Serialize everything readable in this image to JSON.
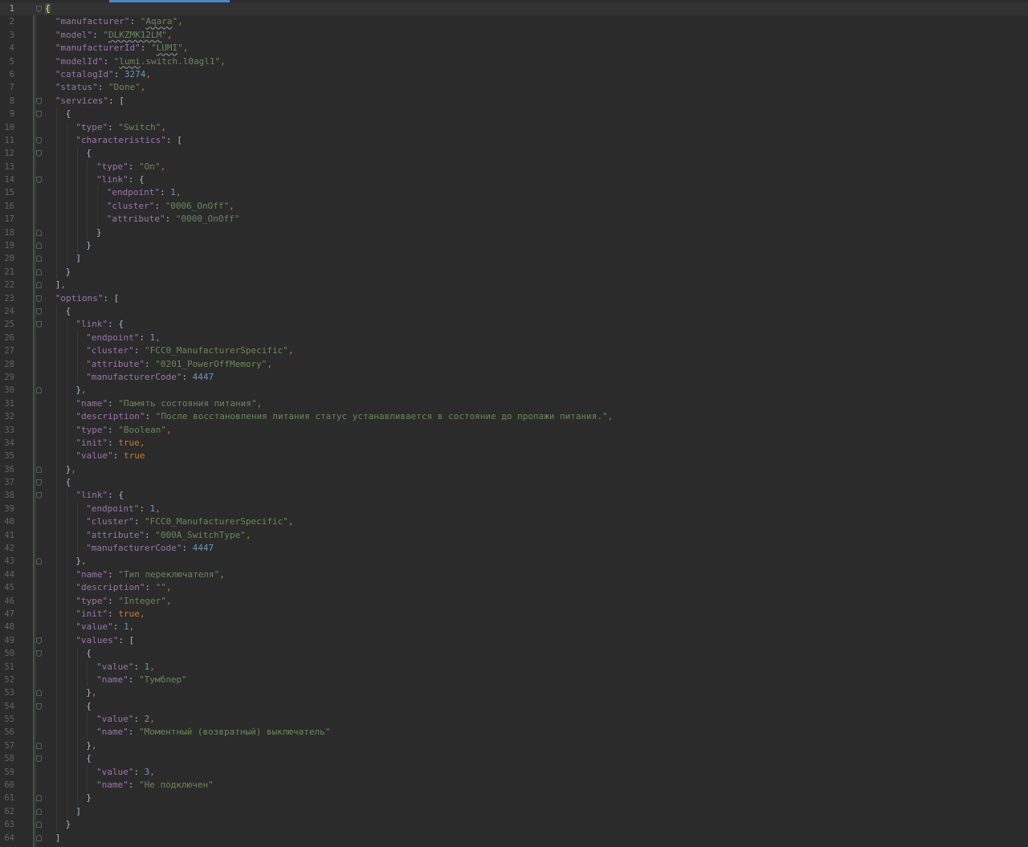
{
  "editor": {
    "active_line": 1,
    "lines": [
      {
        "n": "1",
        "indent": 0,
        "tokens": [
          [
            "brace-hl",
            "{"
          ]
        ],
        "fold": "open"
      },
      {
        "n": "2",
        "indent": 1,
        "tokens": [
          [
            "k",
            "\"manufacturer\""
          ],
          [
            "p",
            ": "
          ],
          [
            "s",
            "\""
          ],
          [
            "s typo",
            "Aqara"
          ],
          [
            "s",
            "\""
          ],
          [
            "cm",
            ","
          ]
        ]
      },
      {
        "n": "3",
        "indent": 1,
        "tokens": [
          [
            "k",
            "\"model\""
          ],
          [
            "p",
            ": "
          ],
          [
            "s",
            "\""
          ],
          [
            "s typo",
            "DLKZMK12LM"
          ],
          [
            "s",
            "\""
          ],
          [
            "cm",
            ","
          ]
        ]
      },
      {
        "n": "4",
        "indent": 1,
        "tokens": [
          [
            "k",
            "\"manufacturerId\""
          ],
          [
            "p",
            ": "
          ],
          [
            "s",
            "\""
          ],
          [
            "s typo",
            "LUMI"
          ],
          [
            "s",
            "\""
          ],
          [
            "cm",
            ","
          ]
        ]
      },
      {
        "n": "5",
        "indent": 1,
        "tokens": [
          [
            "k",
            "\"modelId\""
          ],
          [
            "p",
            ": "
          ],
          [
            "s",
            "\""
          ],
          [
            "s typo",
            "lumi"
          ],
          [
            "s",
            ".switch.l0agl1\""
          ],
          [
            "cm",
            ","
          ]
        ]
      },
      {
        "n": "6",
        "indent": 1,
        "tokens": [
          [
            "k",
            "\"catalogId\""
          ],
          [
            "p",
            ": "
          ],
          [
            "n",
            "3274"
          ],
          [
            "cm",
            ","
          ]
        ]
      },
      {
        "n": "7",
        "indent": 1,
        "tokens": [
          [
            "k",
            "\"status\""
          ],
          [
            "p",
            ": "
          ],
          [
            "s",
            "\"Done\""
          ],
          [
            "cm",
            ","
          ]
        ]
      },
      {
        "n": "8",
        "indent": 1,
        "tokens": [
          [
            "k",
            "\"services\""
          ],
          [
            "p",
            ": ["
          ]
        ],
        "fold": "open"
      },
      {
        "n": "9",
        "indent": 2,
        "tokens": [
          [
            "p",
            "{"
          ]
        ],
        "fold": "open"
      },
      {
        "n": "10",
        "indent": 3,
        "tokens": [
          [
            "k",
            "\"type\""
          ],
          [
            "p",
            ": "
          ],
          [
            "s",
            "\"Switch\""
          ],
          [
            "cm",
            ","
          ]
        ]
      },
      {
        "n": "11",
        "indent": 3,
        "tokens": [
          [
            "k",
            "\"characteristics\""
          ],
          [
            "p",
            ": ["
          ]
        ],
        "fold": "open"
      },
      {
        "n": "12",
        "indent": 4,
        "tokens": [
          [
            "p",
            "{"
          ]
        ],
        "fold": "open"
      },
      {
        "n": "13",
        "indent": 5,
        "tokens": [
          [
            "k",
            "\"type\""
          ],
          [
            "p",
            ": "
          ],
          [
            "s",
            "\"On\""
          ],
          [
            "cm",
            ","
          ]
        ]
      },
      {
        "n": "14",
        "indent": 5,
        "tokens": [
          [
            "k",
            "\"link\""
          ],
          [
            "p",
            ": {"
          ]
        ],
        "fold": "open"
      },
      {
        "n": "15",
        "indent": 6,
        "tokens": [
          [
            "k",
            "\"endpoint\""
          ],
          [
            "p",
            ": "
          ],
          [
            "n",
            "1"
          ],
          [
            "cm",
            ","
          ]
        ]
      },
      {
        "n": "16",
        "indent": 6,
        "tokens": [
          [
            "k",
            "\"cluster\""
          ],
          [
            "p",
            ": "
          ],
          [
            "s",
            "\"0006_OnOff\""
          ],
          [
            "cm",
            ","
          ]
        ]
      },
      {
        "n": "17",
        "indent": 6,
        "tokens": [
          [
            "k",
            "\"attribute\""
          ],
          [
            "p",
            ": "
          ],
          [
            "s",
            "\"0000_OnOff\""
          ]
        ]
      },
      {
        "n": "18",
        "indent": 5,
        "tokens": [
          [
            "p",
            "}"
          ]
        ],
        "fold": "close"
      },
      {
        "n": "19",
        "indent": 4,
        "tokens": [
          [
            "p",
            "}"
          ]
        ],
        "fold": "close"
      },
      {
        "n": "20",
        "indent": 3,
        "tokens": [
          [
            "p",
            "]"
          ]
        ],
        "fold": "close"
      },
      {
        "n": "21",
        "indent": 2,
        "tokens": [
          [
            "p",
            "}"
          ]
        ],
        "fold": "close"
      },
      {
        "n": "22",
        "indent": 1,
        "tokens": [
          [
            "p",
            "]"
          ],
          [
            "cm",
            ","
          ]
        ],
        "fold": "close"
      },
      {
        "n": "23",
        "indent": 1,
        "tokens": [
          [
            "k",
            "\"options\""
          ],
          [
            "p",
            ": ["
          ]
        ],
        "fold": "open"
      },
      {
        "n": "24",
        "indent": 2,
        "tokens": [
          [
            "p",
            "{"
          ]
        ],
        "fold": "open"
      },
      {
        "n": "25",
        "indent": 3,
        "tokens": [
          [
            "k",
            "\"link\""
          ],
          [
            "p",
            ": {"
          ]
        ],
        "fold": "open"
      },
      {
        "n": "26",
        "indent": 4,
        "tokens": [
          [
            "k",
            "\"endpoint\""
          ],
          [
            "p",
            ": "
          ],
          [
            "n",
            "1"
          ],
          [
            "cm",
            ","
          ]
        ]
      },
      {
        "n": "27",
        "indent": 4,
        "tokens": [
          [
            "k",
            "\"cluster\""
          ],
          [
            "p",
            ": "
          ],
          [
            "s",
            "\"FCC0_ManufacturerSpecific\""
          ],
          [
            "cm",
            ","
          ]
        ]
      },
      {
        "n": "28",
        "indent": 4,
        "tokens": [
          [
            "k",
            "\"attribute\""
          ],
          [
            "p",
            ": "
          ],
          [
            "s",
            "\"0201_PowerOffMemory\""
          ],
          [
            "cm",
            ","
          ]
        ]
      },
      {
        "n": "29",
        "indent": 4,
        "tokens": [
          [
            "k",
            "\"manufacturerCode\""
          ],
          [
            "p",
            ": "
          ],
          [
            "n",
            "4447"
          ]
        ]
      },
      {
        "n": "30",
        "indent": 3,
        "tokens": [
          [
            "p",
            "}"
          ],
          [
            "cm",
            ","
          ]
        ],
        "fold": "close"
      },
      {
        "n": "31",
        "indent": 3,
        "tokens": [
          [
            "k",
            "\"name\""
          ],
          [
            "p",
            ": "
          ],
          [
            "s",
            "\"Память состояния питания\""
          ],
          [
            "cm",
            ","
          ]
        ]
      },
      {
        "n": "32",
        "indent": 3,
        "tokens": [
          [
            "k",
            "\"description\""
          ],
          [
            "p",
            ": "
          ],
          [
            "s",
            "\"После восстановления питания статус устанавливается в состояние до пропажи питания.\""
          ],
          [
            "cm",
            ","
          ]
        ]
      },
      {
        "n": "33",
        "indent": 3,
        "tokens": [
          [
            "k",
            "\"type\""
          ],
          [
            "p",
            ": "
          ],
          [
            "s",
            "\"Boolean\""
          ],
          [
            "cm",
            ","
          ]
        ]
      },
      {
        "n": "34",
        "indent": 3,
        "tokens": [
          [
            "k",
            "\"init\""
          ],
          [
            "p",
            ": "
          ],
          [
            "b",
            "true"
          ],
          [
            "cm",
            ","
          ]
        ]
      },
      {
        "n": "35",
        "indent": 3,
        "tokens": [
          [
            "k",
            "\"value\""
          ],
          [
            "p",
            ": "
          ],
          [
            "b",
            "true"
          ]
        ]
      },
      {
        "n": "36",
        "indent": 2,
        "tokens": [
          [
            "p",
            "}"
          ],
          [
            "cm",
            ","
          ]
        ],
        "fold": "close"
      },
      {
        "n": "37",
        "indent": 2,
        "tokens": [
          [
            "p",
            "{"
          ]
        ],
        "fold": "open"
      },
      {
        "n": "38",
        "indent": 3,
        "tokens": [
          [
            "k",
            "\"link\""
          ],
          [
            "p",
            ": {"
          ]
        ],
        "fold": "open"
      },
      {
        "n": "39",
        "indent": 4,
        "tokens": [
          [
            "k",
            "\"endpoint\""
          ],
          [
            "p",
            ": "
          ],
          [
            "n",
            "1"
          ],
          [
            "cm",
            ","
          ]
        ]
      },
      {
        "n": "40",
        "indent": 4,
        "tokens": [
          [
            "k",
            "\"cluster\""
          ],
          [
            "p",
            ": "
          ],
          [
            "s",
            "\"FCC0_ManufacturerSpecific\""
          ],
          [
            "cm",
            ","
          ]
        ]
      },
      {
        "n": "41",
        "indent": 4,
        "tokens": [
          [
            "k",
            "\"attribute\""
          ],
          [
            "p",
            ": "
          ],
          [
            "s",
            "\"000A_SwitchType\""
          ],
          [
            "cm",
            ","
          ]
        ]
      },
      {
        "n": "42",
        "indent": 4,
        "tokens": [
          [
            "k",
            "\"manufacturerCode\""
          ],
          [
            "p",
            ": "
          ],
          [
            "n",
            "4447"
          ]
        ]
      },
      {
        "n": "43",
        "indent": 3,
        "tokens": [
          [
            "p",
            "}"
          ],
          [
            "cm",
            ","
          ]
        ],
        "fold": "close"
      },
      {
        "n": "44",
        "indent": 3,
        "tokens": [
          [
            "k",
            "\"name\""
          ],
          [
            "p",
            ": "
          ],
          [
            "s",
            "\"Тип переключателя\""
          ],
          [
            "cm",
            ","
          ]
        ]
      },
      {
        "n": "45",
        "indent": 3,
        "tokens": [
          [
            "k",
            "\"description\""
          ],
          [
            "p",
            ": "
          ],
          [
            "s",
            "\"\""
          ],
          [
            "cm",
            ","
          ]
        ]
      },
      {
        "n": "46",
        "indent": 3,
        "tokens": [
          [
            "k",
            "\"type\""
          ],
          [
            "p",
            ": "
          ],
          [
            "s",
            "\"Integer\""
          ],
          [
            "cm",
            ","
          ]
        ]
      },
      {
        "n": "47",
        "indent": 3,
        "tokens": [
          [
            "k",
            "\"init\""
          ],
          [
            "p",
            ": "
          ],
          [
            "b",
            "true"
          ],
          [
            "cm",
            ","
          ]
        ]
      },
      {
        "n": "48",
        "indent": 3,
        "tokens": [
          [
            "k",
            "\"value\""
          ],
          [
            "p",
            ": "
          ],
          [
            "n",
            "1"
          ],
          [
            "cm",
            ","
          ]
        ]
      },
      {
        "n": "49",
        "indent": 3,
        "tokens": [
          [
            "k",
            "\"values\""
          ],
          [
            "p",
            ": ["
          ]
        ],
        "fold": "open"
      },
      {
        "n": "50",
        "indent": 4,
        "tokens": [
          [
            "p",
            "{"
          ]
        ],
        "fold": "open"
      },
      {
        "n": "51",
        "indent": 5,
        "tokens": [
          [
            "k",
            "\"value\""
          ],
          [
            "p",
            ": "
          ],
          [
            "n",
            "1"
          ],
          [
            "cm",
            ","
          ]
        ]
      },
      {
        "n": "52",
        "indent": 5,
        "tokens": [
          [
            "k",
            "\"name\""
          ],
          [
            "p",
            ": "
          ],
          [
            "s",
            "\"Тумблер\""
          ]
        ]
      },
      {
        "n": "53",
        "indent": 4,
        "tokens": [
          [
            "p",
            "}"
          ],
          [
            "cm",
            ","
          ]
        ],
        "fold": "close"
      },
      {
        "n": "54",
        "indent": 4,
        "tokens": [
          [
            "p",
            "{"
          ]
        ],
        "fold": "open"
      },
      {
        "n": "55",
        "indent": 5,
        "tokens": [
          [
            "k",
            "\"value\""
          ],
          [
            "p",
            ": "
          ],
          [
            "n",
            "2"
          ],
          [
            "cm",
            ","
          ]
        ]
      },
      {
        "n": "56",
        "indent": 5,
        "tokens": [
          [
            "k",
            "\"name\""
          ],
          [
            "p",
            ": "
          ],
          [
            "s",
            "\"Моментный (возвратный) выключатель\""
          ]
        ]
      },
      {
        "n": "57",
        "indent": 4,
        "tokens": [
          [
            "p",
            "}"
          ],
          [
            "cm",
            ","
          ]
        ],
        "fold": "close"
      },
      {
        "n": "58",
        "indent": 4,
        "tokens": [
          [
            "p",
            "{"
          ]
        ],
        "fold": "open"
      },
      {
        "n": "59",
        "indent": 5,
        "tokens": [
          [
            "k",
            "\"value\""
          ],
          [
            "p",
            ": "
          ],
          [
            "n",
            "3"
          ],
          [
            "cm",
            ","
          ]
        ]
      },
      {
        "n": "60",
        "indent": 5,
        "tokens": [
          [
            "k",
            "\"name\""
          ],
          [
            "p",
            ": "
          ],
          [
            "s",
            "\"Не подключен\""
          ]
        ]
      },
      {
        "n": "61",
        "indent": 4,
        "tokens": [
          [
            "p",
            "}"
          ]
        ],
        "fold": "close"
      },
      {
        "n": "62",
        "indent": 3,
        "tokens": [
          [
            "p",
            "]"
          ]
        ],
        "fold": "close"
      },
      {
        "n": "63",
        "indent": 2,
        "tokens": [
          [
            "p",
            "}"
          ]
        ],
        "fold": "close"
      },
      {
        "n": "64",
        "indent": 1,
        "tokens": [
          [
            "p",
            "]"
          ]
        ],
        "fold": "close"
      }
    ]
  }
}
